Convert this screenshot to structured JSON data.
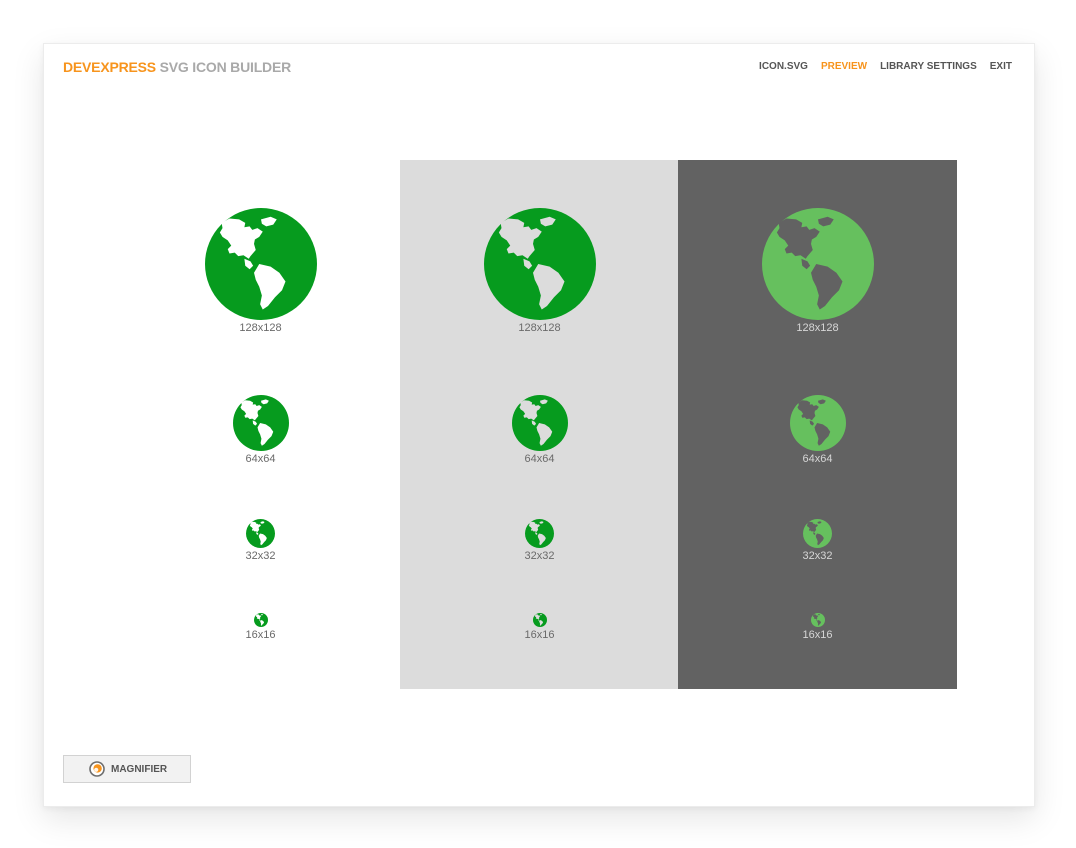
{
  "header": {
    "brand_primary": "DEVEXPRESS",
    "brand_secondary": "SVG ICON BUILDER",
    "nav": [
      {
        "label": "ICON.SVG"
      },
      {
        "label": "PREVIEW"
      },
      {
        "label": "LIBRARY SETTINGS"
      },
      {
        "label": "EXIT"
      }
    ]
  },
  "preview": {
    "icon": "globe-americas-icon",
    "backgrounds": [
      {
        "name": "white",
        "color": "#ffffff"
      },
      {
        "name": "light-gray",
        "color": "#dcdcdc"
      },
      {
        "name": "dark-gray",
        "color": "#626262"
      }
    ],
    "sizes": [
      {
        "label": "128x128"
      },
      {
        "label": "64x64"
      },
      {
        "label": "32x32"
      },
      {
        "label": "16x16"
      }
    ]
  },
  "footer": {
    "magnifier_label": "MAGNIFIER"
  },
  "colors": {
    "accent": "#f7941d",
    "icon_green": "#069b1e",
    "icon_light_green": "#66c05e"
  }
}
